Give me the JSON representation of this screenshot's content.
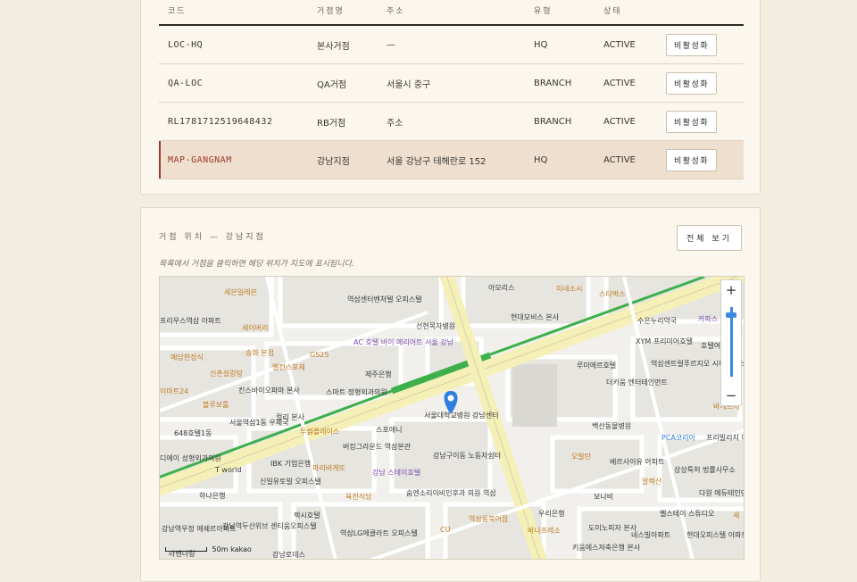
{
  "locations_table": {
    "headers": [
      "코드",
      "거점명",
      "주소",
      "유형",
      "상태",
      ""
    ],
    "rows": [
      {
        "code": "LOC-HQ",
        "name": "본사거점",
        "address": "—",
        "type": "HQ",
        "status": "ACTIVE",
        "action": "비활성화",
        "selected": false
      },
      {
        "code": "QA-LOC",
        "name": "QA거점",
        "address": "서울시 중구",
        "type": "BRANCH",
        "status": "ACTIVE",
        "action": "비활성화",
        "selected": false
      },
      {
        "code": "RL1781712519648432",
        "name": "RB거점",
        "address": "주소",
        "type": "BRANCH",
        "status": "ACTIVE",
        "action": "비활성화",
        "selected": false
      },
      {
        "code": "MAP-GANGNAM",
        "name": "강남지점",
        "address": "서울 강남구 테헤란로 152",
        "type": "HQ",
        "status": "ACTIVE",
        "action": "비활성화",
        "selected": true
      }
    ]
  },
  "map_panel": {
    "title": "거점 위치 — 강남지점",
    "view_all_label": "전체 보기",
    "hint": "목록에서 거점을 클릭하면 해당 위치가 지도에 표시됩니다.",
    "zoom_in": "+",
    "zoom_out": "−",
    "scale_label": "50m",
    "provider": "kakao",
    "pin_color": "#2f7fe0",
    "labels": [
      "세븐일레븐",
      "역삼센터벤처텔 오피스텔",
      "아모리스",
      "미네소시",
      "스타벅스",
      "프리우스역삼 아파트",
      "세이버리",
      "현대모비스 본사",
      "선현목자병원",
      "수은누리약국",
      "카파스",
      "예담한정식",
      "송화 본점",
      "AC 호텔 바이 메리어트 서울 강남",
      "XYM 프리미어호텔",
      "호텔여",
      "신촌설렁탕",
      "벨컨스포제",
      "GS25",
      "루미에르호텔",
      "역삼센트럴푸르지오 시티오피스텔",
      "이마트24",
      "킨스바이오파마 본사",
      "제주은행",
      "스마트 정형외과의원",
      "더키움 엔터테인먼트",
      "블루보틀",
      "서울역삼1동 우체국",
      "컬리 본사",
      "스포애니",
      "서울대학교병원 강남센터",
      "백산동물병원",
      "바게트케",
      "648호텔1동",
      "투썸플레이스",
      "버킹그라운드 역삼본관",
      "PCA코리아",
      "프리빌리지 아파트",
      "디에이 성형외과의원",
      "IBK 기업은행",
      "파리바게뜨",
      "강남 스테이호텔",
      "강남구이동 노동자쉼터",
      "오발탄",
      "베르사이유 아파트",
      "T world",
      "신일유토빌 오피스텔",
      "상상특허 법률사무소",
      "하나은행",
      "알렉산",
      "육전식당",
      "숨엔소리이비인후과 의원 역삼",
      "보나비",
      "다원 에듀테인먼트",
      "렉시호텔",
      "우리은행",
      "벨스테이 스튜디오",
      "강남역우정 에쉐르아파트",
      "강남역두산위브 센티움오피스텔",
      "역삼LG에클라트 오피스텔",
      "역삼동북어집",
      "도미노피자 본사",
      "현대오피스텔 아파트",
      "CU",
      "바나프레소",
      "키움에스저축은행 본사",
      "네스빌아파트",
      "세",
      "라벤더링",
      "강남로데스"
    ]
  }
}
